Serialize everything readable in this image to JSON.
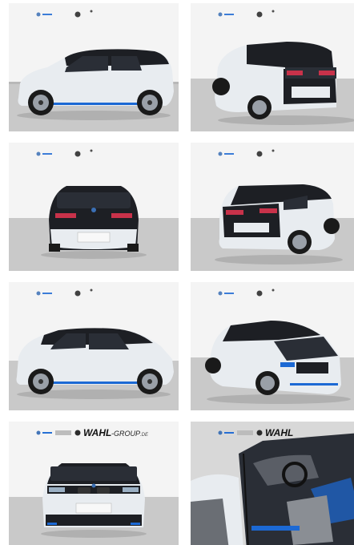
{
  "gallery": {
    "dealer_name": "WAHL",
    "dealer_suffix": "-GROUP",
    "dealer_tld": ".DE",
    "images": [
      {
        "view": "side-left"
      },
      {
        "view": "rear-left-three-quarter"
      },
      {
        "view": "rear"
      },
      {
        "view": "rear-right-three-quarter"
      },
      {
        "view": "side-left-2"
      },
      {
        "view": "front-right-three-quarter"
      },
      {
        "view": "front"
      },
      {
        "view": "interior-driver-door"
      }
    ]
  },
  "colors": {
    "body_white": "#e8ecf0",
    "roof_black": "#1d1f24",
    "accent_blue": "#1c69d4",
    "floor": "#c9c9c9",
    "wall": "#f2f2f2"
  }
}
